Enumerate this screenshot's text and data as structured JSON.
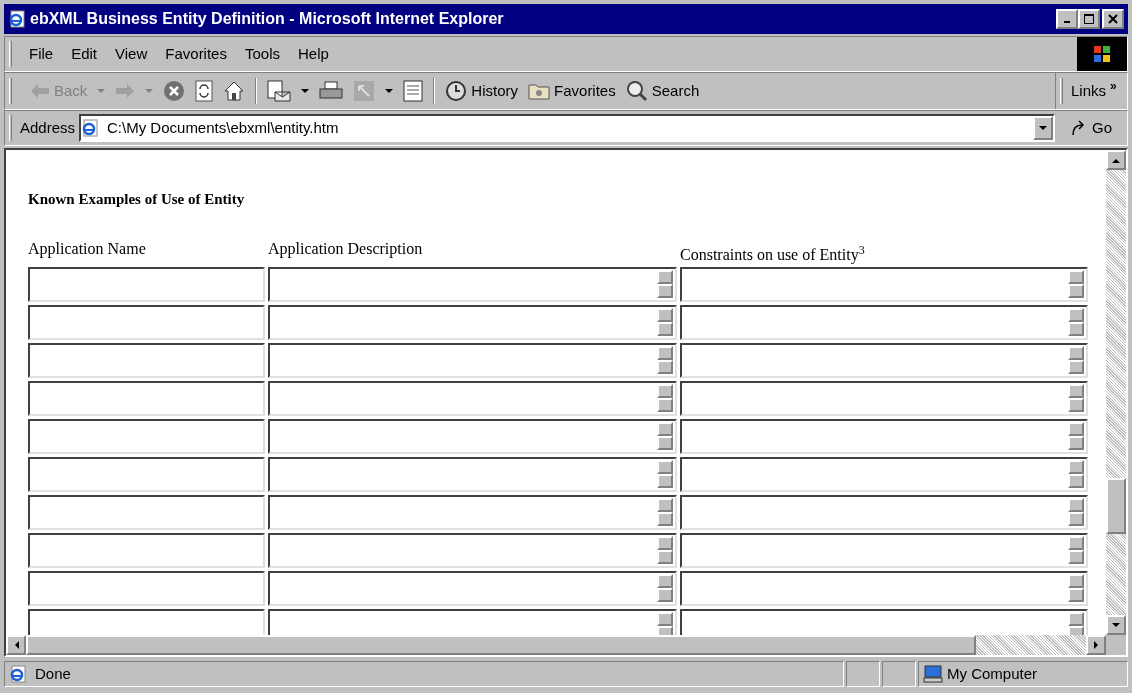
{
  "window": {
    "title": "ebXML Business Entity Definition - Microsoft Internet Explorer"
  },
  "menu": [
    "File",
    "Edit",
    "View",
    "Favorites",
    "Tools",
    "Help"
  ],
  "toolbar": {
    "back": {
      "label": "Back",
      "disabled": true
    },
    "history": "History",
    "favorites": "Favorites",
    "search": "Search",
    "links": "Links",
    "chevron": "»"
  },
  "address": {
    "label": "Address",
    "value": "C:\\My Documents\\ebxml\\entity.htm",
    "go": "Go"
  },
  "page": {
    "heading": "Known Examples of Use of Entity",
    "columns": [
      "Application Name",
      "Application Description",
      "Constraints on use of Entity$^{3}$"
    ],
    "rows": [
      {
        "kind": "entry"
      },
      {
        "kind": "entry"
      },
      {
        "kind": "entry"
      },
      {
        "kind": "entry"
      },
      {
        "kind": "entry"
      },
      {
        "kind": "entry"
      },
      {
        "kind": "entry"
      },
      {
        "kind": "entry"
      },
      {
        "kind": "entry"
      },
      {
        "kind": "entry"
      }
    ]
  },
  "status_bar": {
    "text": "Done",
    "zone": "My Computer"
  }
}
